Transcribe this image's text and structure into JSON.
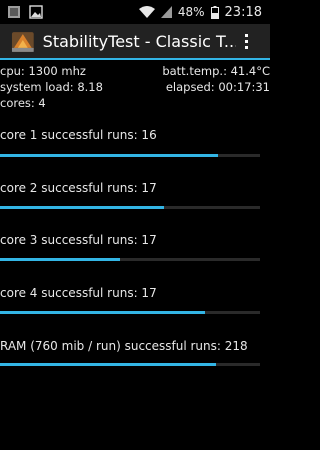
{
  "status_bar": {
    "battery": "48%",
    "time": "23:18",
    "icons": [
      "notification-app-icon",
      "image-icon",
      "wifi-icon",
      "signal-icon",
      "battery-icon"
    ]
  },
  "action_bar": {
    "title": "StabilityTest - Classic T...",
    "app_icon": "stabilitytest-app-icon",
    "menu_icon": "overflow-menu-icon"
  },
  "stats": {
    "cpu": "cpu: 1300 mhz",
    "batt_temp": "batt.temp.: 41.4°C",
    "system_load": "system load: 8.18",
    "elapsed": "elapsed: 00:17:31",
    "cores": "cores: 4"
  },
  "items": [
    {
      "label": "core 1 successful runs: 16",
      "progress": 0.84
    },
    {
      "label": "core 2 successful runs: 17",
      "progress": 0.63
    },
    {
      "label": "core 3 successful runs: 17",
      "progress": 0.46
    },
    {
      "label": "core 4 successful runs: 17",
      "progress": 0.79
    },
    {
      "label": "RAM (760 mib / run) successful runs: 218",
      "progress": 0.83
    }
  ],
  "colors": {
    "accent": "#33b5e5",
    "background": "#000000",
    "actionbar": "#222222"
  }
}
